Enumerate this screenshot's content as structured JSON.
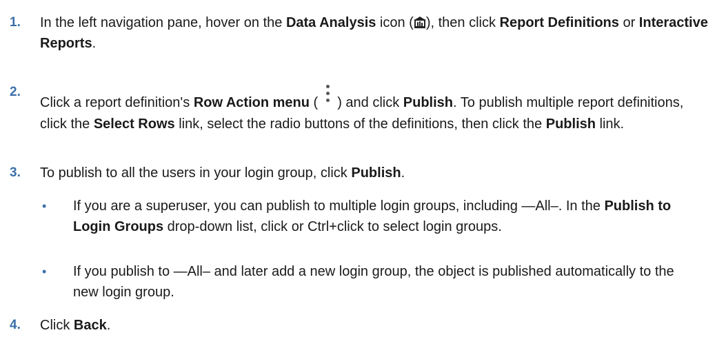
{
  "steps": [
    {
      "num": "1.",
      "t1": "In the left navigation pane, hover on the ",
      "b1": "Data Analysis",
      "t2": " icon (",
      "t3": "), then click ",
      "b2": "Report Definitions",
      "t4": " or ",
      "b3": "Interactive Reports",
      "t5": "."
    },
    {
      "num": "2.",
      "t1": "Click a report definition's ",
      "b1": "Row Action menu",
      "t2": " (",
      "t3": ") and click ",
      "b2": "Publish",
      "t4": ". To publish multiple report definitions, click the ",
      "b3": "Select Rows",
      "t5": " link, select the radio buttons of the definitions, then click the ",
      "b4": "Publish",
      "t6": " link."
    },
    {
      "num": "3.",
      "t1": "To publish to all the users in your login group, click ",
      "b1": "Publish",
      "t2": "."
    },
    {
      "num": "4.",
      "t1": "Click ",
      "b1": "Back",
      "t2": "."
    }
  ],
  "bullets": [
    {
      "t1": "If you are a superuser, you can publish to multiple login groups, including —All–. In the ",
      "b1": "Publish to Login Groups",
      "t2": " drop-down list, click or Ctrl+click to select login groups."
    },
    {
      "t1": "If you publish to —All– and later add a new login group, the object is published automatically to the new login group."
    }
  ],
  "icons": {
    "data_analysis": "data-analysis-icon",
    "row_action": "kebab-menu-icon"
  }
}
